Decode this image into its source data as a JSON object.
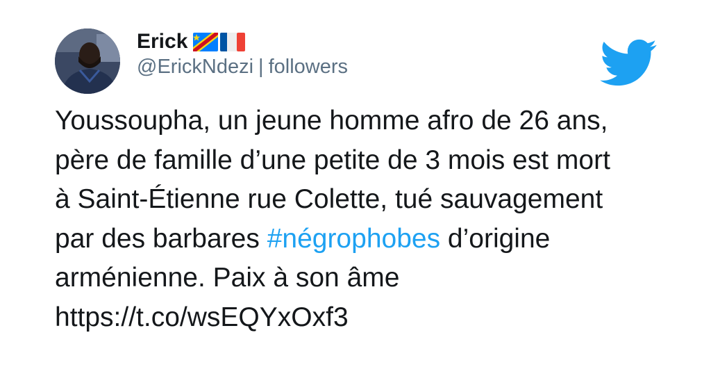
{
  "author": {
    "display_name": "Erick",
    "flags": [
      "dr-congo-flag-icon",
      "france-flag-icon"
    ],
    "handle": "@ErickNdezi",
    "separator": "|",
    "followers_label": "followers",
    "avatar_icon": "avatar"
  },
  "brand": {
    "icon": "twitter-bird-icon",
    "color": "#1DA1F2"
  },
  "tweet": {
    "lines": [
      "Youssoupha, un jeune homme afro de 26 ans,",
      "père de famille d’une petite de 3 mois est mort",
      "à Saint-Étienne rue Colette, tué sauvagement"
    ],
    "line4_before": "par des barbares ",
    "hashtag": "#négrophobes",
    "line4_after": " d’origine",
    "line5": "arménienne. Paix à son âme",
    "link": "https://t.co/wsEQYxOxf3"
  },
  "colors": {
    "text": "#14171A",
    "secondary": "#5B7083",
    "link": "#1DA1F2",
    "background": "#FFFFFF"
  }
}
